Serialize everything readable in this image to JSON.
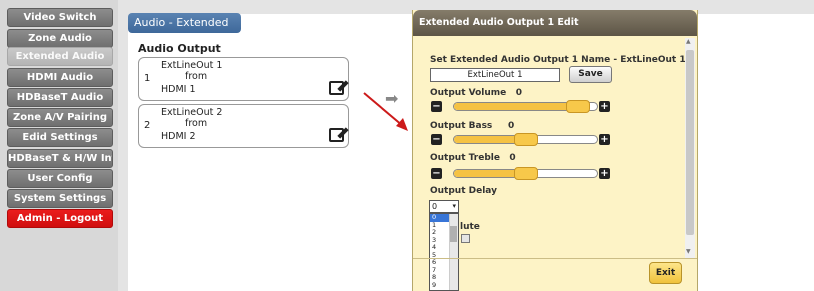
{
  "sidebar": {
    "items": [
      {
        "label": "Video Switch"
      },
      {
        "label": "Zone Audio"
      },
      {
        "label": "Extended Audio"
      },
      {
        "label": "HDMI Audio"
      },
      {
        "label": "HDBaseT Audio"
      },
      {
        "label": "Zone A/V Pairing"
      },
      {
        "label": "Edid Settings"
      },
      {
        "label": "HDBaseT & H/W Info"
      },
      {
        "label": "User Config"
      },
      {
        "label": "System Settings"
      },
      {
        "label": "Admin - Logout"
      }
    ]
  },
  "panel": {
    "tab_label": "Audio - Extended",
    "section_title": "Audio Output",
    "outputs": [
      {
        "num": "1",
        "name": "ExtLineOut 1",
        "from": "from",
        "source": "HDMI 1"
      },
      {
        "num": "2",
        "name": "ExtLineOut 2",
        "from": "from",
        "source": "HDMI 2"
      }
    ]
  },
  "modal": {
    "title": "Extended Audio Output 1 Edit",
    "name_label": "Set Extended Audio Output 1 Name - ExtLineOut 1",
    "name_value": "ExtLineOut 1",
    "save_label": "Save",
    "volume_label": "Output Volume",
    "volume_value": "0",
    "bass_label": "Output Bass",
    "bass_value": "0",
    "treble_label": "Output Treble",
    "treble_value": "0",
    "delay_label": "Output Delay",
    "delay_value": "0",
    "delay_options": [
      "0",
      "1",
      "2",
      "3",
      "4",
      "5",
      "6",
      "7",
      "8",
      "9"
    ],
    "mute_label_partial": "lute",
    "exit_label": "Exit",
    "volume_level": 0.86,
    "bass_level": 0.5,
    "treble_level": 0.5
  },
  "colors": {
    "logout": "#d8141a",
    "tab": "#4a72a5",
    "modal_bg": "#fdf3c6",
    "slider_fill": "#f5c243"
  }
}
